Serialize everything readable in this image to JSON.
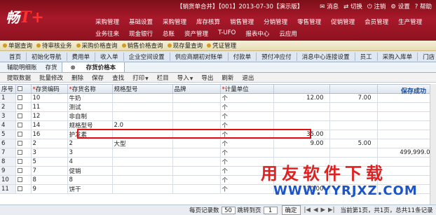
{
  "header": {
    "logo_text": "畅",
    "logo_mark": "T+",
    "login_info": "【销货单合并】【001】2013-07-30【演示版】",
    "top_icons": [
      "消息",
      "切换",
      "注销",
      "设置",
      "帮助"
    ],
    "nav_row1": [
      "采购管理",
      "基础设置",
      "采购管理",
      "库存核算",
      "销售管理",
      "分销管理",
      "零售管理",
      "促销管理",
      "会员管理",
      "生产管理"
    ],
    "nav_row2": [
      "业务往来",
      "现金银行",
      "总账",
      "资产管理",
      "T-UFO",
      "报表中心",
      "云应用"
    ]
  },
  "quickbar": [
    "单据查询",
    "待审核业务",
    "采购价格查询",
    "销售价格查询",
    "现存量查询",
    "凭证管理"
  ],
  "module_tabs": [
    "首页",
    "初始化导航",
    "费用单",
    "收入单",
    "企业空间设置",
    "供应商期初对账单",
    "付款单",
    "预付冲应付",
    "消息中心连接设置",
    "员工",
    "采购入库单",
    "门店"
  ],
  "doc_tabs": [
    "辅助明细账",
    "存货",
    "存货价格本"
  ],
  "toolbar": [
    "提取数据",
    "批量修改",
    "删除",
    "保存",
    "查找",
    "打印",
    "栏目",
    "导入",
    "导出",
    "刷新",
    "退出"
  ],
  "grid": {
    "status": "保存成功",
    "columns": [
      "序号",
      "",
      "存货编码",
      "存货名称",
      "规格型号",
      "品牌",
      "计量单位",
      "",
      "",
      ""
    ],
    "rows": [
      {
        "no": "1",
        "code": "10",
        "name": "牛奶",
        "spec": "",
        "brand": "",
        "unit": "个",
        "p1": "12.00",
        "p2": "7.00",
        "p3": ""
      },
      {
        "no": "2",
        "code": "11",
        "name": "测试",
        "spec": "",
        "brand": "",
        "unit": "个",
        "p1": "",
        "p2": "",
        "p3": ""
      },
      {
        "no": "3",
        "code": "12",
        "name": "非自制",
        "spec": "",
        "brand": "",
        "unit": "个",
        "p1": "",
        "p2": "",
        "p3": ""
      },
      {
        "no": "4",
        "code": "14",
        "name": "规格型号",
        "spec": "2.0",
        "brand": "",
        "unit": "个",
        "p1": "",
        "p2": "",
        "p3": ""
      },
      {
        "no": "5",
        "code": "16",
        "name": "护发素",
        "spec": "",
        "brand": "",
        "unit": "个",
        "p1": "35.00",
        "p2": "",
        "p3": ""
      },
      {
        "no": "6",
        "code": "2",
        "name": "2",
        "spec": "大型",
        "brand": "",
        "unit": "个",
        "p1": "9.00",
        "p2": "5.00",
        "p3": ""
      },
      {
        "no": "7",
        "code": "3",
        "name": "3",
        "spec": "",
        "brand": "",
        "unit": "个",
        "p1": "",
        "p2": "",
        "p3": "499,999.0"
      },
      {
        "no": "8",
        "code": "5",
        "name": "4",
        "spec": "",
        "brand": "",
        "unit": "个",
        "p1": "",
        "p2": "",
        "p3": ""
      },
      {
        "no": "9",
        "code": "7",
        "name": "促销",
        "spec": "",
        "brand": "",
        "unit": "个",
        "p1": "",
        "p2": "",
        "p3": ""
      },
      {
        "no": "10",
        "code": "8",
        "name": "8",
        "spec": "",
        "brand": "",
        "unit": "个",
        "p1": "",
        "p2": "",
        "p3": ""
      },
      {
        "no": "11",
        "code": "9",
        "name": "饼干",
        "spec": "",
        "brand": "",
        "unit": "个",
        "p1": "10.00",
        "p2": "",
        "p3": ""
      }
    ]
  },
  "watermark": {
    "line1": "用友软件下载",
    "line2": "WWW.YYRJXZ.COM"
  },
  "pager": {
    "per_page_label": "每页记录数",
    "per_page": "50",
    "jump_label": "跳转到页",
    "jump_page": "1",
    "confirm": "确定",
    "summary": "当前第1页，共1页，总共11条记录"
  },
  "colors": {
    "banner": "#a8192a",
    "status": "#1b4e9a",
    "highlight": "#e01010",
    "watermark_red": "#e02020",
    "watermark_blue": "#1c55c8"
  }
}
